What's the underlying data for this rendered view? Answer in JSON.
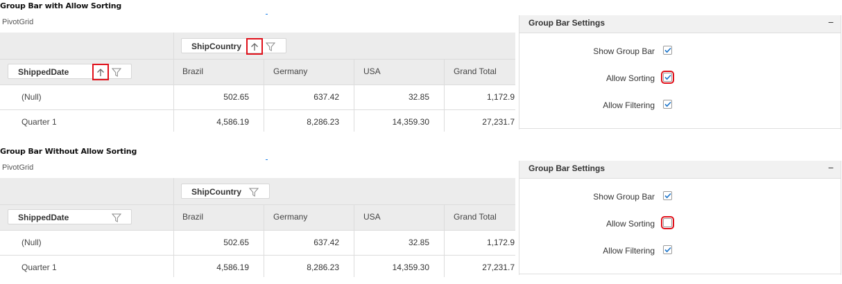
{
  "sections": [
    {
      "title": "Group Bar with Allow Sorting",
      "pivot_label": "PivotGrid",
      "column_field": "ShipCountry",
      "row_field": "ShippedDate",
      "columns": [
        "Brazil",
        "Germany",
        "USA",
        "Grand Total"
      ],
      "rows": [
        {
          "label": "(Null)",
          "values": [
            "502.65",
            "637.42",
            "32.85",
            "1,172.9"
          ]
        },
        {
          "label": "Quarter 1",
          "values": [
            "4,586.19",
            "8,286.23",
            "14,359.30",
            "27,231.7"
          ]
        }
      ],
      "settings": {
        "title": "Group Bar Settings",
        "collapse_glyph": "−",
        "options": [
          {
            "label": "Show Group Bar",
            "checked": true
          },
          {
            "label": "Allow Sorting",
            "checked": true
          },
          {
            "label": "Allow Filtering",
            "checked": true
          }
        ]
      },
      "sort_icons_visible": true
    },
    {
      "title": "Group Bar Without Allow Sorting",
      "pivot_label": "PivotGrid",
      "column_field": "ShipCountry",
      "row_field": "ShippedDate",
      "columns": [
        "Brazil",
        "Germany",
        "USA",
        "Grand Total"
      ],
      "rows": [
        {
          "label": "(Null)",
          "values": [
            "502.65",
            "637.42",
            "32.85",
            "1,172.9"
          ]
        },
        {
          "label": "Quarter 1",
          "values": [
            "4,586.19",
            "8,286.23",
            "14,359.30",
            "27,231.7"
          ]
        }
      ],
      "settings": {
        "title": "Group Bar Settings",
        "collapse_glyph": "−",
        "options": [
          {
            "label": "Show Group Bar",
            "checked": true
          },
          {
            "label": "Allow Sorting",
            "checked": false
          },
          {
            "label": "Allow Filtering",
            "checked": true
          }
        ]
      },
      "sort_icons_visible": false
    }
  ],
  "colors": {
    "highlight": "#e0101a",
    "check": "#1a73c9"
  },
  "icons": {
    "sort": "arrow-up-icon",
    "filter": "funnel-icon"
  }
}
